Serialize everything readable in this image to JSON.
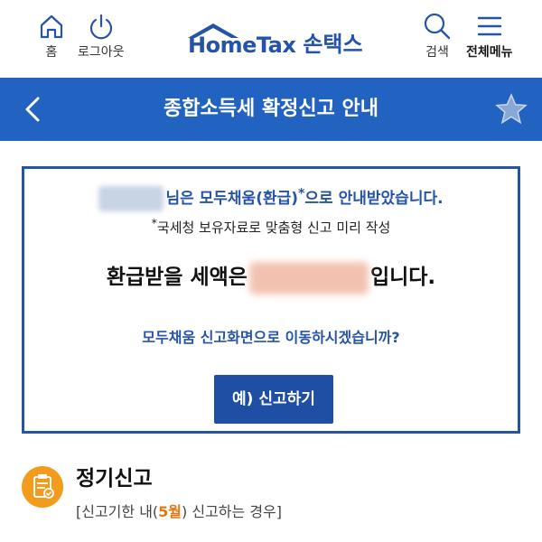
{
  "header": {
    "home_label": "홈",
    "logout_label": "로그아웃",
    "logo_text": "HomeTax",
    "logo_sub": "손택스",
    "search_label": "검색",
    "menu_label": "전체메뉴"
  },
  "nav": {
    "title": "종합소득세 확정신고 안내"
  },
  "notice": {
    "line1_suffix": "님은 모두채움(환급)",
    "line1_asterisk": "*",
    "line1_end": "으로 안내받았습니다.",
    "line2_asterisk": "*",
    "line2_text": "국세청 보유자료로 맞춤형 신고 미리 작성",
    "refund_prefix": "환급받을 세액은",
    "refund_suffix": "입니다.",
    "question": "모두채움 신고화면으로 이동하시겠습니까?",
    "button_label": "예) 신고하기"
  },
  "section": {
    "title": "정기신고",
    "desc_open": "[신고기한 내(",
    "desc_highlight": "5월",
    "desc_close": ") 신고하는 경우]"
  },
  "colors": {
    "brand_blue": "#2553a8",
    "nav_blue": "#2262c0",
    "accent_orange": "#f29b1d"
  }
}
